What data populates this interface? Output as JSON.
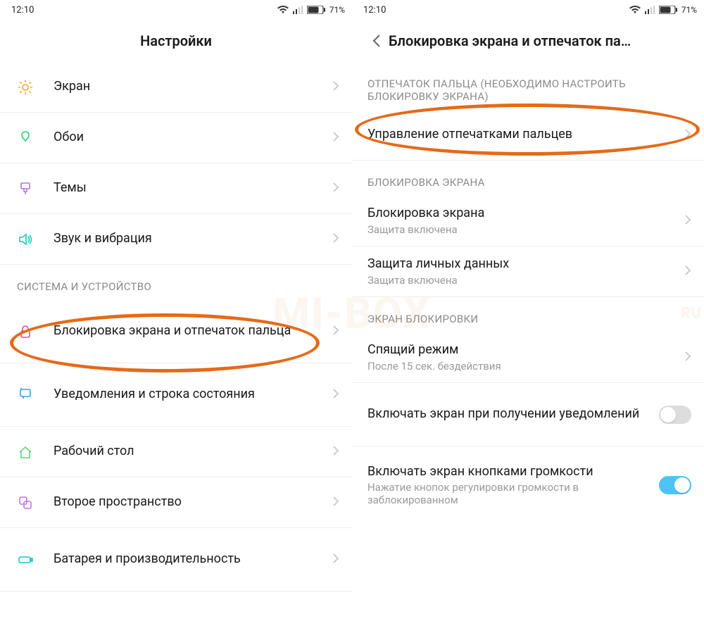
{
  "status": {
    "time": "12:10",
    "battery_pct": "71%"
  },
  "left": {
    "title": "Настройки",
    "items": [
      {
        "label": "Экран"
      },
      {
        "label": "Обои"
      },
      {
        "label": "Темы"
      },
      {
        "label": "Звук и вибрация"
      }
    ],
    "section_system": "СИСТЕМА И УСТРОЙСТВО",
    "items2": [
      {
        "label": "Блокировка экрана и отпечаток пальца"
      },
      {
        "label": "Уведомления и строка состояния"
      },
      {
        "label": "Рабочий стол"
      },
      {
        "label": "Второе пространство"
      },
      {
        "label": "Батарея и производительность"
      }
    ]
  },
  "right": {
    "title": "Блокировка экрана и отпечаток па…",
    "section_fp": "ОТПЕЧАТОК ПАЛЬЦА (НЕОБХОДИМО НАСТРОИТЬ БЛОКИРОВКУ ЭКРАНА)",
    "items_fp": [
      {
        "label": "Управление отпечатками пальцев"
      }
    ],
    "section_lock": "БЛОКИРОВКА ЭКРАНА",
    "items_lock": [
      {
        "label": "Блокировка экрана",
        "sub": "Защита включена"
      },
      {
        "label": "Защита личных данных",
        "sub": "Защита включена"
      }
    ],
    "section_ls": "ЭКРАН БЛОКИРОВКИ",
    "items_ls": [
      {
        "label": "Спящий режим",
        "sub": "После 15 сек. бездействия"
      },
      {
        "label": "Включать экран при получении уведомлений",
        "toggle": false
      },
      {
        "label": "Включать экран кнопками громкости",
        "sub": "Нажатие кнопок регулировки громкости в заблокированном",
        "toggle": true
      }
    ]
  },
  "watermark": "MI-BOX",
  "watermark2": "RU"
}
